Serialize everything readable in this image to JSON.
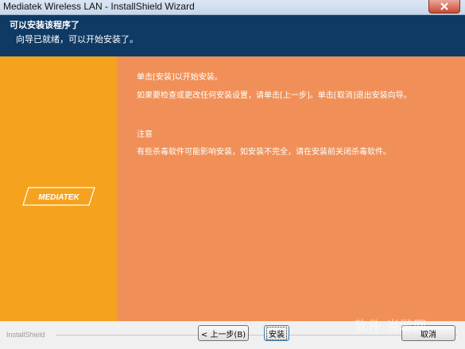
{
  "window": {
    "title": "Mediatek Wireless LAN - InstallShield Wizard"
  },
  "header": {
    "title": "可以安装该程序了",
    "subtitle": "向导已就绪，可以开始安装了。"
  },
  "side": {
    "logo_text": "MEDIATEK"
  },
  "main": {
    "line1": "单击[安装]以开始安装。",
    "line2": "如果要检查或更改任何安装设置，请单击[上一步]。单击[取消]退出安装向导。",
    "note_label": "注意",
    "note_text": "有些杀毒软件可能影响安装，如安装不完全，请在安装前关闭杀毒软件。"
  },
  "footer": {
    "brand": "InstallShield",
    "back_label": "< 上一步(B)",
    "install_label": "安装",
    "cancel_label": "取消"
  },
  "watermark": "软件 当游网",
  "colors": {
    "header_bg": "#0f3a64",
    "side_bg": "#f5a21e",
    "main_bg": "#f09058"
  }
}
